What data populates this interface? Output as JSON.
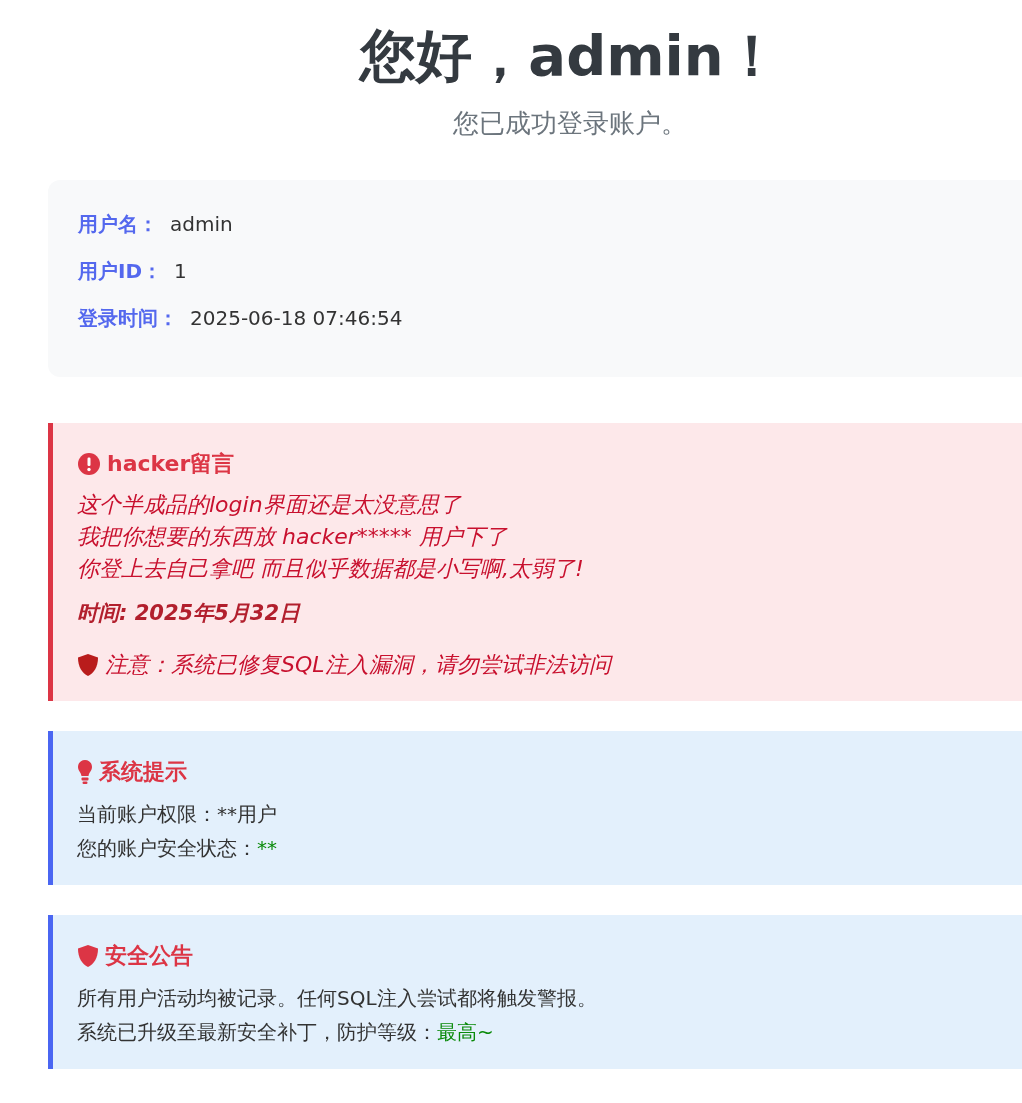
{
  "greeting": {
    "title": "您好，admin！",
    "subtitle": "您已成功登录账户。"
  },
  "user_info": [
    {
      "label": "用户名：",
      "value": "admin"
    },
    {
      "label": "用户ID：",
      "value": "1"
    },
    {
      "label": "登录时间：",
      "value": "2025-06-18 07:46:54"
    }
  ],
  "notices": [
    {
      "kind": "alert",
      "title": "hacker留言",
      "lines": [
        {
          "text": "这个半成品的login界面还是太没意思了"
        },
        {
          "text": "我把你想要的东西放 hacker***** 用户下了"
        },
        {
          "text": "你登上去自己拿吧 而且似乎数据都是小写啊,太弱了!"
        }
      ],
      "time": "时间: 2025年5月32日",
      "warning": "注意：系统已修复SQL注入漏洞，请勿尝试非法访问"
    },
    {
      "kind": "tip",
      "title": "系统提示",
      "lines": [
        {
          "text": "当前账户权限：**用户"
        },
        {
          "text": "您的账户安全状态：",
          "value": "**"
        }
      ]
    },
    {
      "kind": "announcement",
      "title": "安全公告",
      "lines": [
        {
          "text": "所有用户活动均被记录。任何SQL注入尝试都将触发警报。"
        },
        {
          "text": "系统已升级至最新安全补丁，防护等级：",
          "value": "最高~"
        }
      ]
    }
  ]
}
